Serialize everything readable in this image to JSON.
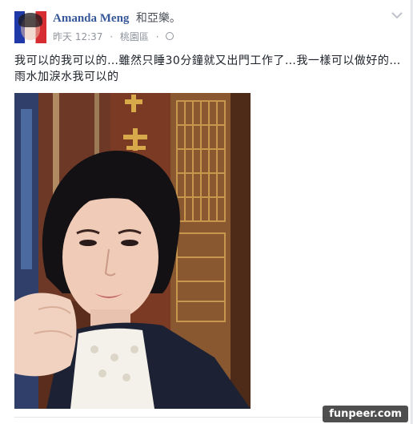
{
  "post": {
    "author": "Amanda Meng",
    "with_text": "和亞樂。",
    "timestamp": "昨天 12:37",
    "separator": "·",
    "location": "桃園區",
    "privacy_icon": "globe-icon",
    "menu_icon": "chevron-down-icon",
    "text": "我可以的我可以的…雖然只睡30分鐘就又出門工作了…我一樣可以做好的…雨水加淚水我可以的",
    "photo_description_icon": "selfie-photo"
  },
  "watermark": {
    "text": "funpeer.com"
  },
  "colors": {
    "author": "#365899",
    "meta": "#90949c",
    "text": "#1d2129"
  }
}
